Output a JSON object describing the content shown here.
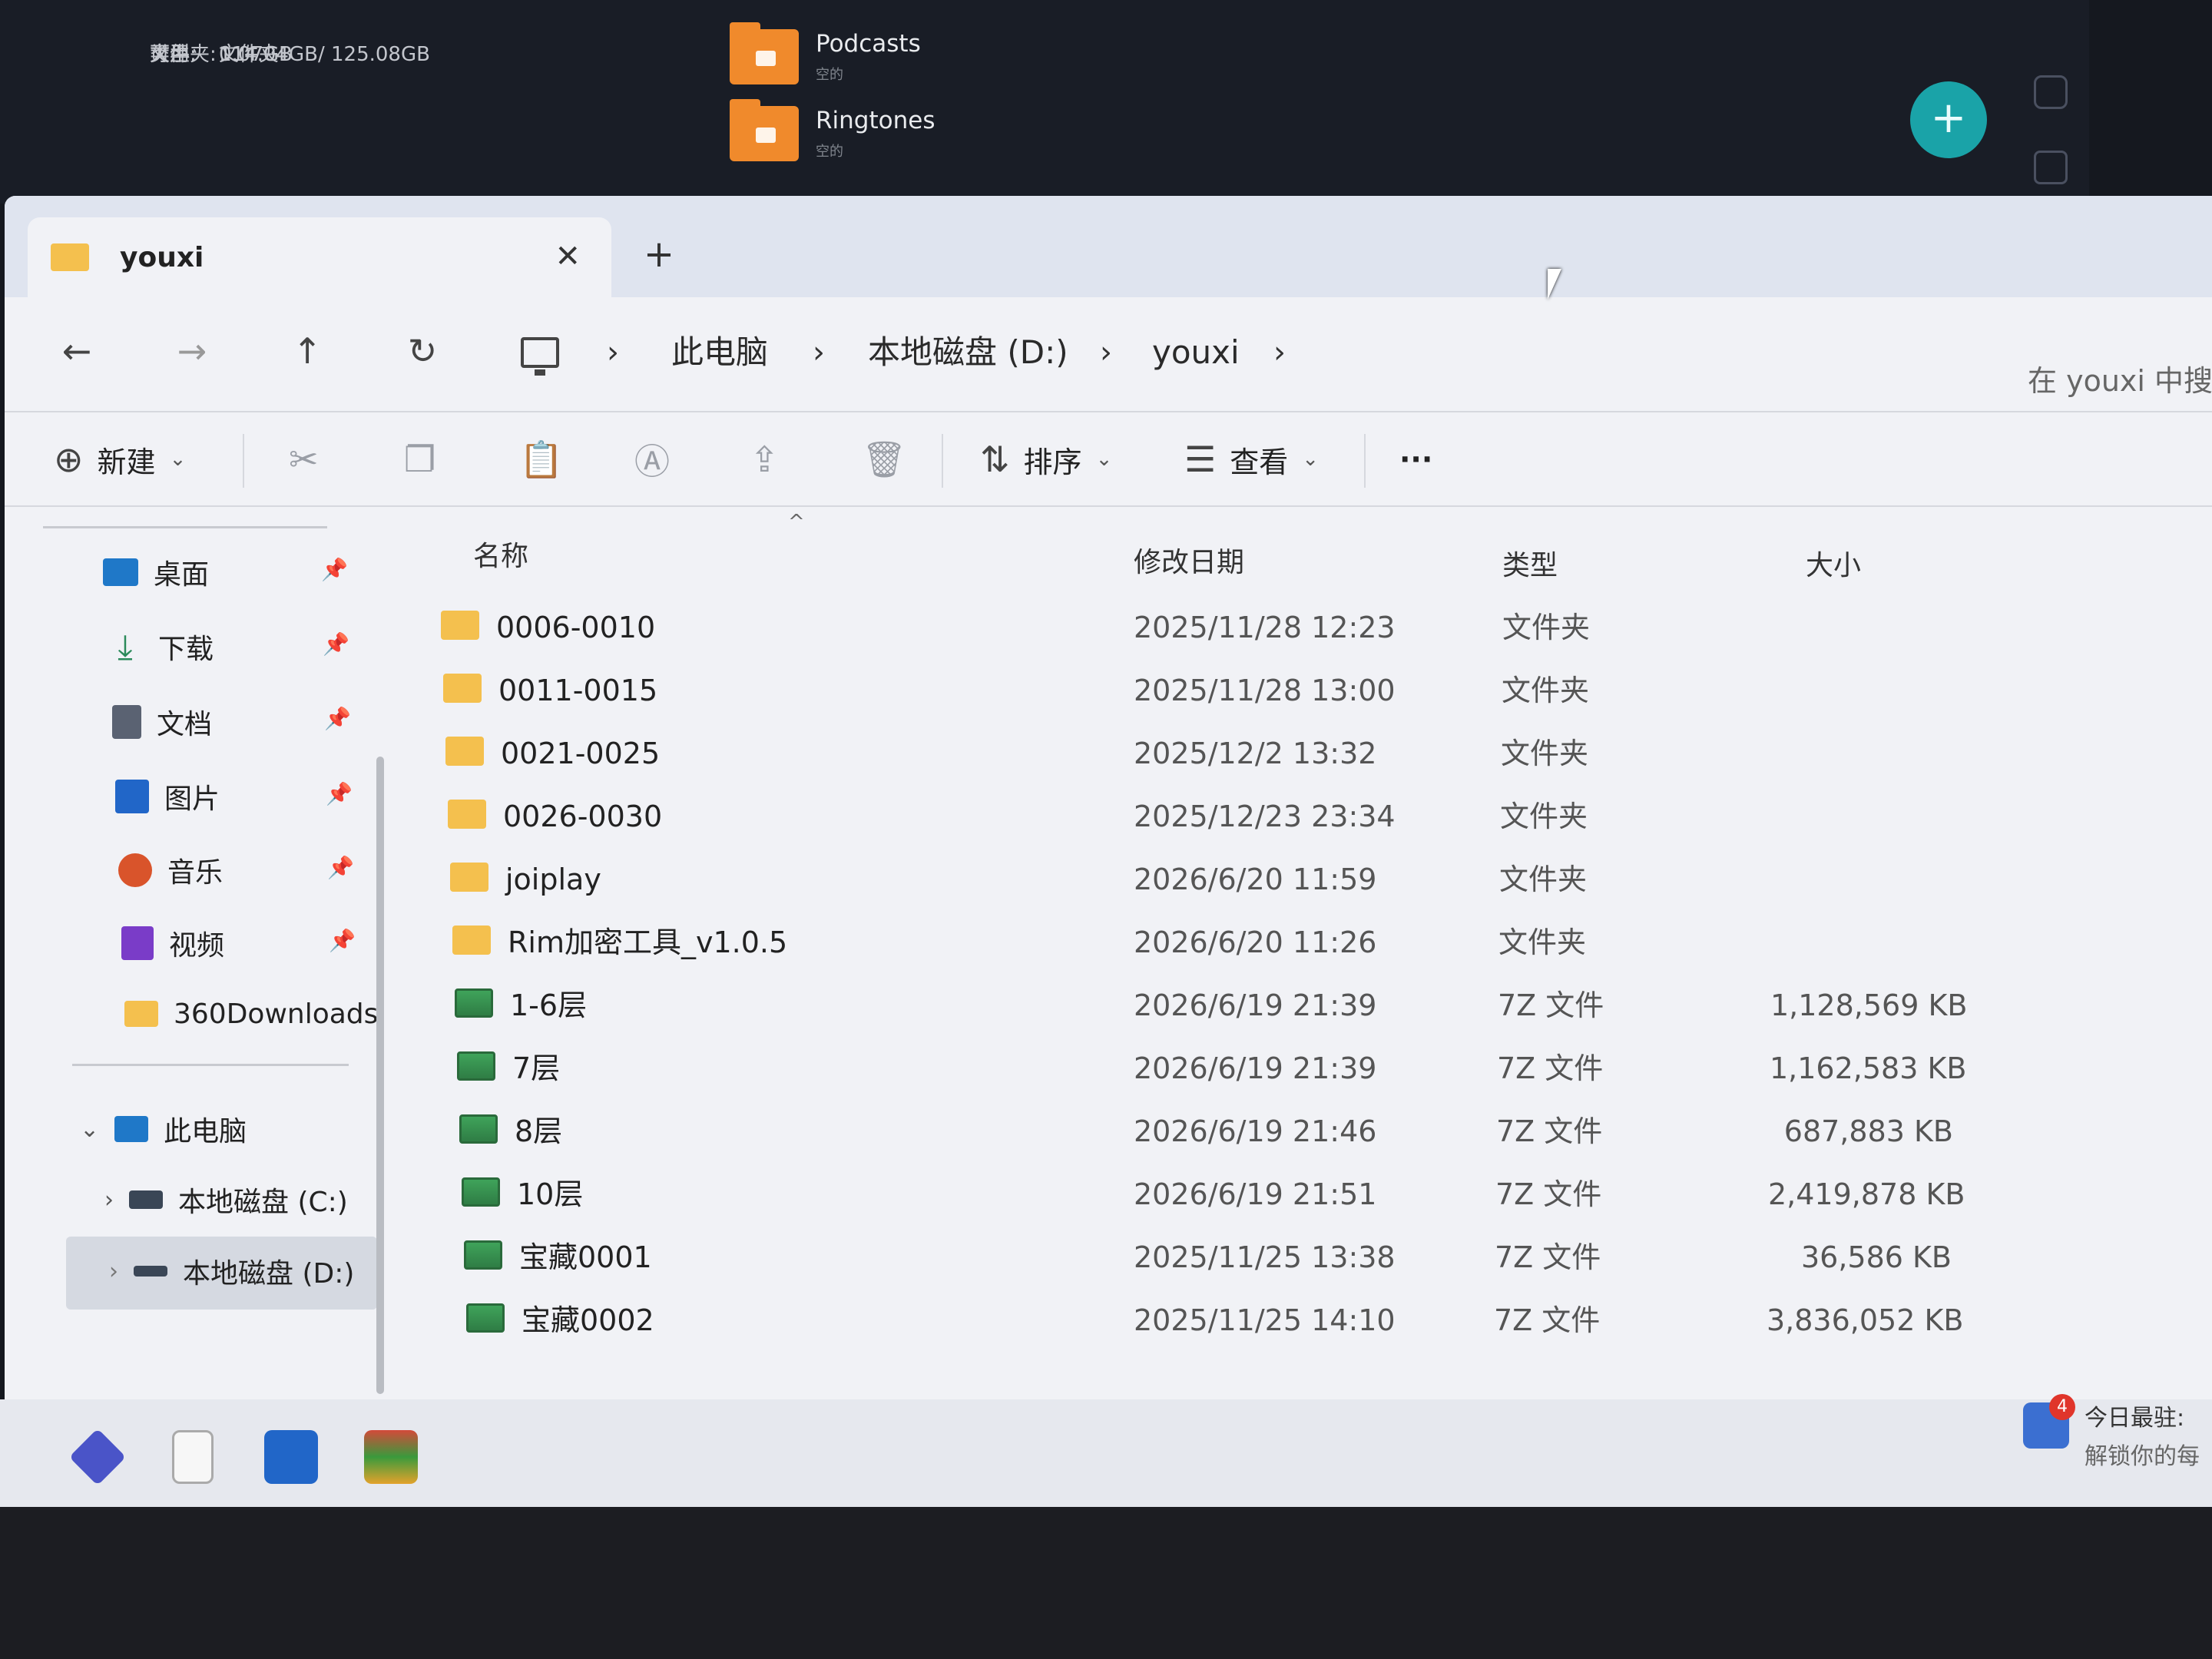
{
  "desktop_info": {
    "type_label": "类型:",
    "type_value": "文件夹",
    "free_label": "可用:",
    "free_value": "114.04GB/ 125.08GB",
    "folders_label": "文件夹:",
    "folders_value": "0",
    "size_label": "大小:",
    "size_value": "1.07GB"
  },
  "desktop_items": [
    {
      "name": "Podcasts",
      "sub": "空的"
    },
    {
      "name": "Ringtones",
      "sub": "空的"
    }
  ],
  "fab_label": "+",
  "tab": {
    "title": "youxi",
    "close": "✕",
    "new_tab": "+"
  },
  "nav": {
    "back": "←",
    "forward": "→",
    "up": "↑",
    "refresh": "↻",
    "breadcrumb": [
      "此电脑",
      "本地磁盘 (D:)",
      "youxi"
    ],
    "search_placeholder": "在 youxi 中搜索"
  },
  "toolbar": {
    "new_label": "新建",
    "sort_label": "排序",
    "view_label": "查看",
    "more_label": "···"
  },
  "sidebar": {
    "quick_access": [
      {
        "label": "桌面",
        "icon": "desktop-icon",
        "color": "#1f78c8"
      },
      {
        "label": "下载",
        "icon": "download-icon",
        "color": "#2b8a5a"
      },
      {
        "label": "文档",
        "icon": "document-icon",
        "color": "#5a6272"
      },
      {
        "label": "图片",
        "icon": "picture-icon",
        "color": "#2166c8"
      },
      {
        "label": "音乐",
        "icon": "music-icon",
        "color": "#d9542b"
      },
      {
        "label": "视频",
        "icon": "video-icon",
        "color": "#7a3cc8"
      },
      {
        "label": "360Downloads",
        "icon": "folder-icon",
        "color": "#f4c04e"
      }
    ],
    "this_pc": "此电脑",
    "drives": [
      "本地磁盘 (C:)",
      "本地磁盘 (D:)"
    ]
  },
  "columns": {
    "name": "名称",
    "modified": "修改日期",
    "type": "类型",
    "size": "大小"
  },
  "files": [
    {
      "name": "0006-0010",
      "modified": "2025/11/28 12:23",
      "type": "文件夹",
      "size": "",
      "kind": "folder"
    },
    {
      "name": "0011-0015",
      "modified": "2025/11/28 13:00",
      "type": "文件夹",
      "size": "",
      "kind": "folder"
    },
    {
      "name": "0021-0025",
      "modified": "2025/12/2 13:32",
      "type": "文件夹",
      "size": "",
      "kind": "folder"
    },
    {
      "name": "0026-0030",
      "modified": "2025/12/23 23:34",
      "type": "文件夹",
      "size": "",
      "kind": "folder"
    },
    {
      "name": "joiplay",
      "modified": "2026/6/20 11:59",
      "type": "文件夹",
      "size": "",
      "kind": "folder"
    },
    {
      "name": "Rim加密工具_v1.0.5",
      "modified": "2026/6/20 11:26",
      "type": "文件夹",
      "size": "",
      "kind": "folder"
    },
    {
      "name": "1-6层",
      "modified": "2026/6/19 21:39",
      "type": "7Z 文件",
      "size": "1,128,569 KB",
      "kind": "archive"
    },
    {
      "name": "7层",
      "modified": "2026/6/19 21:39",
      "type": "7Z 文件",
      "size": "1,162,583 KB",
      "kind": "archive"
    },
    {
      "name": "8层",
      "modified": "2026/6/19 21:46",
      "type": "7Z 文件",
      "size": "687,883 KB",
      "kind": "archive"
    },
    {
      "name": "10层",
      "modified": "2026/6/19 21:51",
      "type": "7Z 文件",
      "size": "2,419,878 KB",
      "kind": "archive"
    },
    {
      "name": "宝藏0001",
      "modified": "2025/11/25 13:38",
      "type": "7Z 文件",
      "size": "36,586 KB",
      "kind": "archive"
    },
    {
      "name": "宝藏0002",
      "modified": "2025/11/25 14:10",
      "type": "7Z 文件",
      "size": "3,836,052 KB",
      "kind": "archive"
    }
  ],
  "notification": {
    "badge": "4",
    "title": "今日最驻:",
    "subtitle": "解锁你的每"
  }
}
